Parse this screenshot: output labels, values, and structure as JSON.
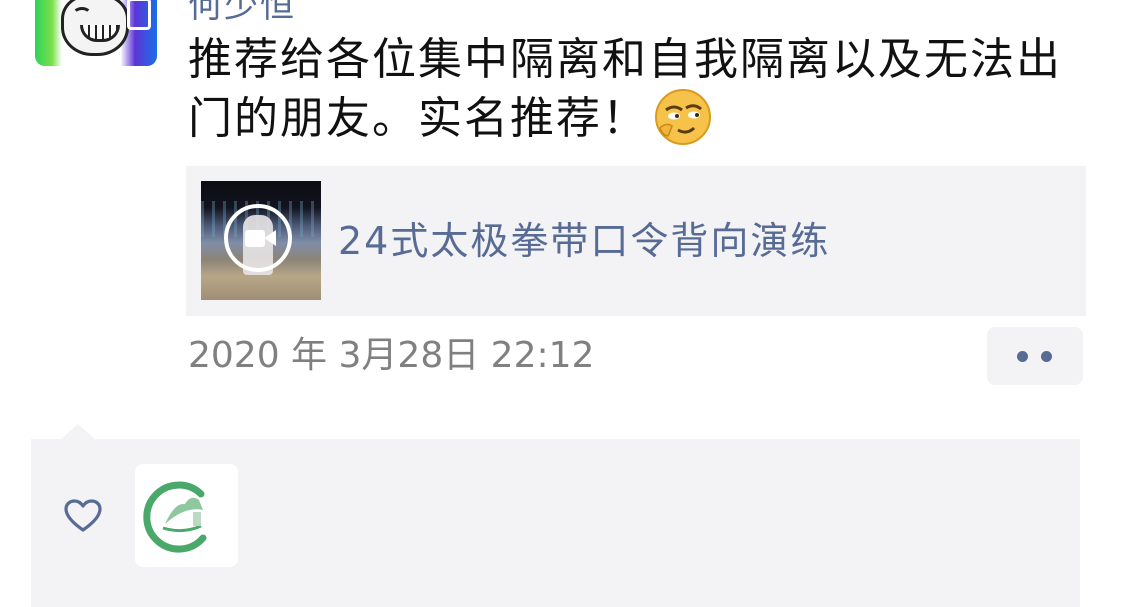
{
  "post": {
    "author_name_partial": "何少恒",
    "text": "推荐给各位集中隔离和自我隔离以及无法出门的朋友。实名推荐！",
    "emoji": "smirk-face-emoji",
    "link": {
      "title": "24式太极拳带口令背向演练",
      "thumbnail": "video-thumbnail-taichi",
      "badge": "video-camera-icon"
    },
    "timestamp": "2020 年 3月28日 22:12",
    "more_button": "more-options-icon"
  },
  "likes": {
    "icon": "heart-icon",
    "liker_avatars": [
      "liker-avatar-logo"
    ]
  },
  "colors": {
    "link_blue": "#576b95",
    "text_black": "#111111",
    "timestamp_gray": "#808080",
    "panel_gray": "#f3f3f5"
  }
}
